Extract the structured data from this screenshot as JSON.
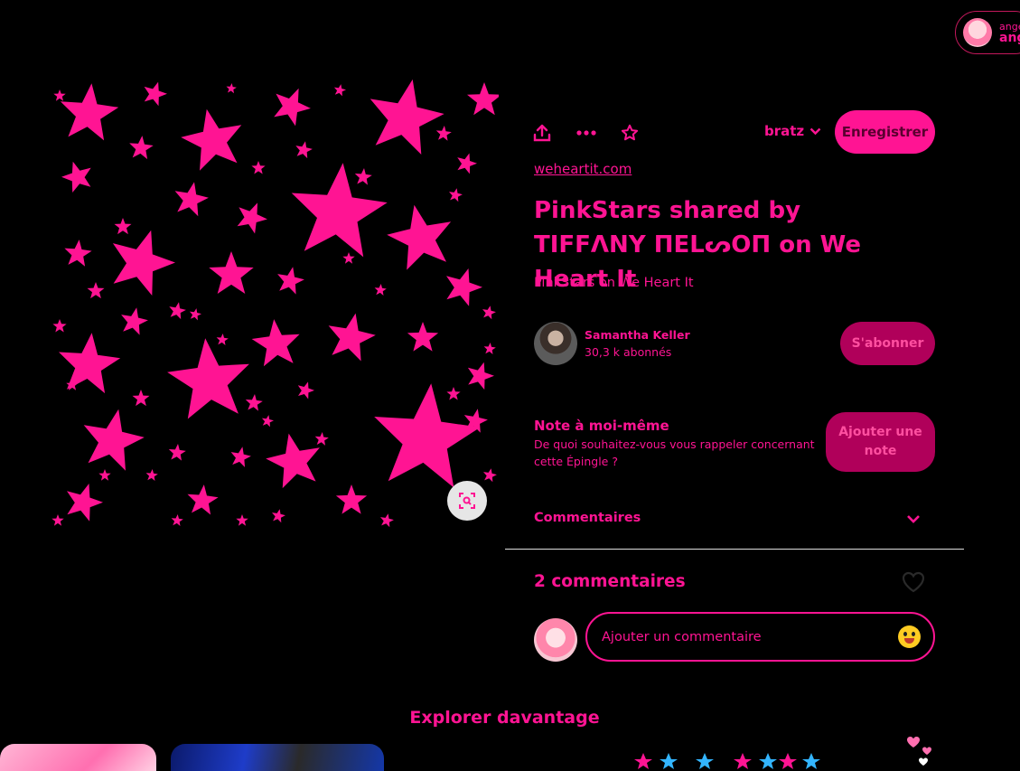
{
  "account": {
    "line1": "ange",
    "line2": "ang"
  },
  "toolbar": {
    "share": "share-icon",
    "more": "more-icon",
    "favorite": "star-icon"
  },
  "board": {
    "name": "bratz"
  },
  "save_label": "Enregistrer",
  "pin": {
    "source": "weheartit.com",
    "title": "PinkStars shared by TIFFΛNY ΠELᔕOΠ on We Heart It",
    "description": "PinkStars on We Heart It"
  },
  "creator": {
    "name": "Samantha Keller",
    "followers": "30,3 k abonnés",
    "follow_label": "S'abonner"
  },
  "note": {
    "title": "Note à moi-même",
    "subtitle": "De quoi souhaitez-vous vous rappeler concernant cette Épingle ?",
    "button": "Ajouter une note"
  },
  "comments": {
    "heading": "Commentaires",
    "count": "2 commentaires",
    "placeholder": "Ajouter un commentaire"
  },
  "explore": "Explorer davantage",
  "colors": {
    "accent": "#ff1493",
    "background": "#000000",
    "muted_button": "#b0005a"
  }
}
